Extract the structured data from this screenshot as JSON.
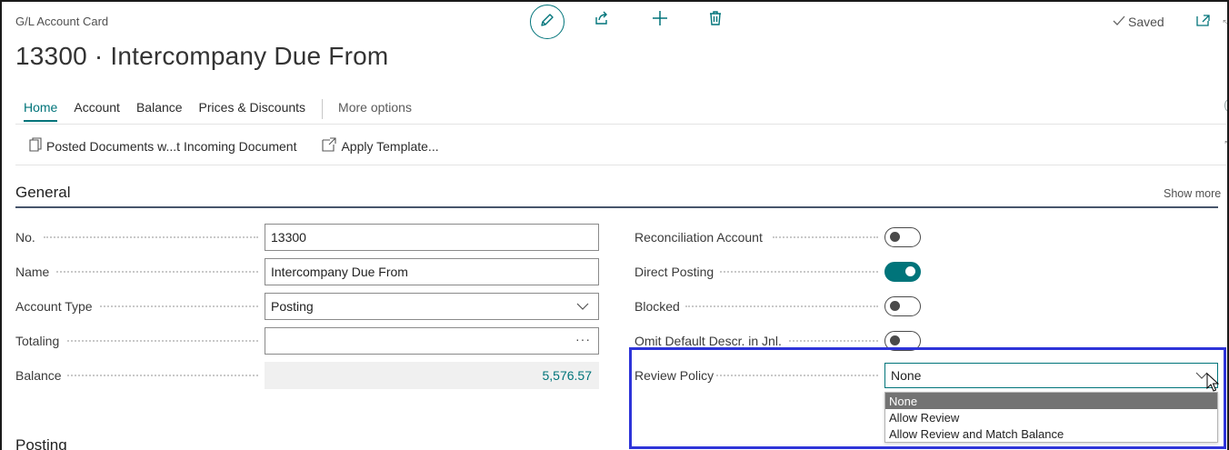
{
  "header": {
    "card_label": "G/L Account Card",
    "title": "13300 · Intercompany Due From",
    "saved_label": "Saved",
    "icons": [
      "edit-icon",
      "share-icon",
      "new-icon",
      "delete-icon",
      "open-new-window-icon"
    ]
  },
  "tabs": {
    "home": "Home",
    "account": "Account",
    "balance": "Balance",
    "prices": "Prices & Discounts",
    "more": "More options"
  },
  "actions": {
    "posted_docs": "Posted Documents w...t Incoming Document",
    "apply_template": "Apply Template..."
  },
  "general": {
    "title": "General",
    "show_more": "Show more",
    "left": {
      "no_label": "No.",
      "no_value": "13300",
      "name_label": "Name",
      "name_value": "Intercompany Due From",
      "account_type_label": "Account Type",
      "account_type_value": "Posting",
      "totaling_label": "Totaling",
      "totaling_value": "",
      "balance_label": "Balance",
      "balance_value": "5,576.57"
    },
    "right": {
      "reconciliation_label": "Reconciliation Account",
      "reconciliation_on": false,
      "direct_posting_label": "Direct Posting",
      "direct_posting_on": true,
      "blocked_label": "Blocked",
      "blocked_on": false,
      "omit_label": "Omit Default Descr. in Jnl.",
      "omit_on": false,
      "review_policy_label": "Review Policy",
      "review_policy_value": "None",
      "review_policy_options": [
        "None",
        "Allow Review",
        "Allow Review and Match Balance"
      ]
    }
  },
  "posting_section": {
    "title": "Posting"
  },
  "colors": {
    "accent": "#00747a",
    "highlight_box": "#2e34d9",
    "section_rule": "#47556b"
  }
}
